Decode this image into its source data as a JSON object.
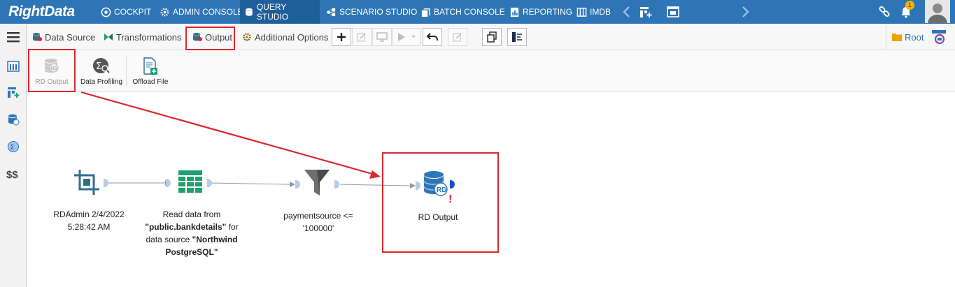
{
  "app": {
    "logo": "RightData"
  },
  "topnav": {
    "items": [
      {
        "label": "COCKPIT",
        "icon": "cockpit-icon"
      },
      {
        "label": "ADMIN CONSOLE",
        "icon": "gear-icon"
      },
      {
        "label": "QUERY STUDIO",
        "icon": "database-icon",
        "active": true
      },
      {
        "label": "SCENARIO STUDIO",
        "icon": "scenario-icon"
      },
      {
        "label": "BATCH CONSOLE",
        "icon": "batch-icon"
      },
      {
        "label": "REPORTING",
        "icon": "report-icon"
      },
      {
        "label": "IMDB",
        "icon": "imdb-icon"
      }
    ],
    "notification_count": "1"
  },
  "toolbar": {
    "tabs": [
      {
        "label": "Data Source",
        "icon": "database-icon"
      },
      {
        "label": "Transformations",
        "icon": "transform-icon"
      },
      {
        "label": "Output",
        "icon": "output-icon",
        "selected": true
      },
      {
        "label": "Additional Options",
        "icon": "gear-icon"
      }
    ],
    "root_label": "Root"
  },
  "ribbon": {
    "items": [
      {
        "label": "RD Output",
        "icon": "rd-output-icon",
        "disabled": true
      },
      {
        "label": "Data Profiling",
        "icon": "data-profiling-icon"
      },
      {
        "label": "Offload File",
        "icon": "offload-file-icon"
      }
    ]
  },
  "canvas": {
    "nodes": [
      {
        "id": "source",
        "icon": "crop-icon",
        "label_lines": [
          "RDAdmin 2/4/2022",
          "5:28:42 AM"
        ]
      },
      {
        "id": "read",
        "icon": "table-icon",
        "label_parts": [
          {
            "text": "Read data from",
            "bold": false
          },
          {
            "text": "\"public.bankdetails\"",
            "bold": true
          },
          {
            "text": " for",
            "bold": false
          },
          {
            "text": "data source ",
            "bold": false
          },
          {
            "text": "\"Northwind",
            "bold": true
          },
          {
            "text": "PostgreSQL\"",
            "bold": true
          }
        ]
      },
      {
        "id": "filter",
        "icon": "funnel-icon",
        "label_lines": [
          "paymentsource <=",
          "'100000'"
        ]
      },
      {
        "id": "output",
        "icon": "rd-output-icon",
        "label_lines": [
          "RD Output"
        ],
        "warning": "!"
      }
    ]
  },
  "colors": {
    "topbar": "#2e75b6",
    "highlight": "#d9272e",
    "node_icon": "#2e6f8e",
    "table_icon": "#1f9e6e"
  }
}
